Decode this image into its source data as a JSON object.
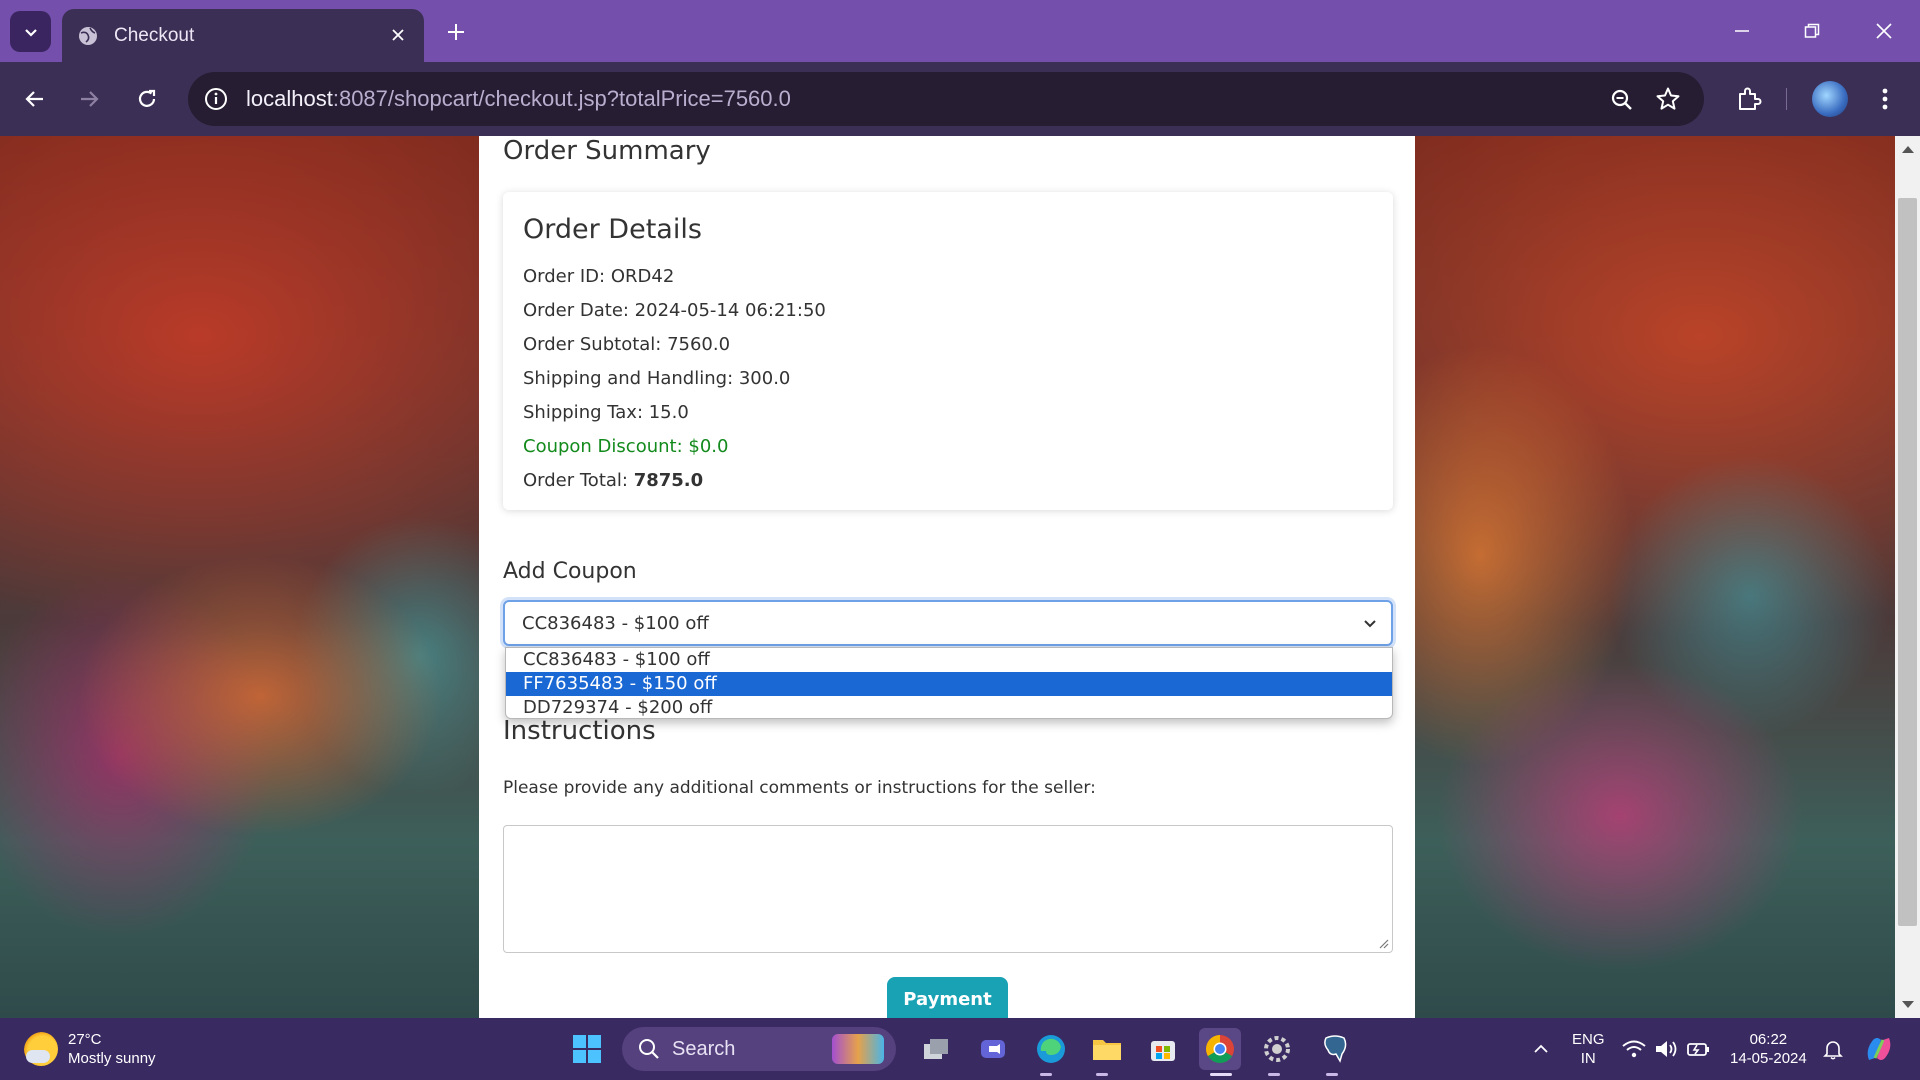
{
  "browser": {
    "tab_title": "Checkout",
    "url_host": "localhost",
    "url_path": ":8087/shopcart/checkout.jsp?totalPrice=7560.0"
  },
  "page": {
    "order_summary_heading": "Order Summary",
    "order_details": {
      "heading": "Order Details",
      "order_id": "Order ID: ORD42",
      "order_date": "Order Date: 2024-05-14 06:21:50",
      "subtotal": "Order Subtotal: 7560.0",
      "shipping": "Shipping and Handling: 300.0",
      "shipping_tax": "Shipping Tax: 15.0",
      "coupon_discount": "Coupon Discount: $0.0",
      "total_label": "Order Total: ",
      "total_value": "7875.0"
    },
    "coupon": {
      "heading": "Add Coupon",
      "selected": "CC836483 - $100 off",
      "options": [
        "CC836483 - $100 off",
        "FF7635483 - $150 off",
        "DD729374 - $200 off"
      ],
      "highlighted_index": 1
    },
    "instructions": {
      "heading": "Instructions",
      "prompt": "Please provide any additional comments or instructions for the seller:",
      "value": ""
    },
    "payment_button": "Payment"
  },
  "taskbar": {
    "weather_temp": "27°C",
    "weather_desc": "Mostly sunny",
    "search_label": "Search",
    "lang_top": "ENG",
    "lang_bottom": "IN",
    "time": "06:22",
    "date": "14-05-2024"
  },
  "colors": {
    "titlebar": "#7450ac",
    "toolbar": "#3c2f55",
    "accent_select": "#1a68d4",
    "coupon_green": "#138a1c",
    "payment_button": "#19a2b4",
    "taskbar": "#3a2a62"
  }
}
